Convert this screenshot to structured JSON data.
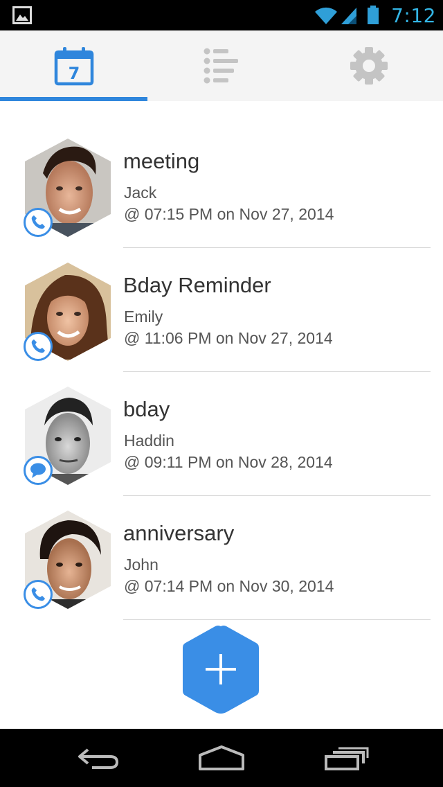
{
  "status_bar": {
    "time": "7:12",
    "icons": [
      "image-notification-icon",
      "wifi-icon",
      "signal-icon",
      "battery-icon"
    ]
  },
  "tabs": [
    {
      "name": "calendar",
      "icon": "calendar-icon",
      "icon_day": "7",
      "active": true
    },
    {
      "name": "list",
      "icon": "list-icon",
      "active": false
    },
    {
      "name": "settings",
      "icon": "gear-icon",
      "active": false
    }
  ],
  "reminders": [
    {
      "title": "meeting",
      "person": "Jack",
      "time": "@ 07:15 PM on Nov 27, 2014",
      "channel": "phone-icon"
    },
    {
      "title": "Bday Reminder",
      "person": "Emily",
      "time": "@ 11:06 PM on Nov 27, 2014",
      "channel": "phone-icon"
    },
    {
      "title": "bday",
      "person": "Haddin",
      "time": "@ 09:11 PM on Nov 28, 2014",
      "channel": "message-icon"
    },
    {
      "title": "anniversary",
      "person": "John",
      "time": "@ 07:14 PM on Nov 30, 2014",
      "channel": "phone-icon"
    }
  ],
  "fab": {
    "icon": "plus-icon"
  },
  "colors": {
    "accent": "#2f86dc",
    "status_text": "#33b5e5",
    "tab_bg": "#f4f4f4",
    "inactive_icon": "#c4c4c4"
  }
}
